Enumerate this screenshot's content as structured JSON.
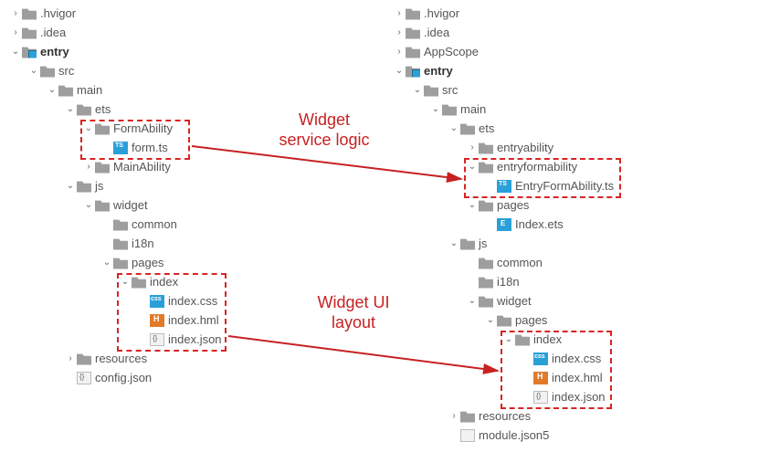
{
  "callouts": {
    "service": {
      "line1": "Widget",
      "line2": "service logic"
    },
    "ui": {
      "line1": "Widget UI",
      "line2": "layout"
    }
  },
  "left_tree": [
    {
      "indent": 0,
      "arrow": "right",
      "icon": "folder",
      "label": ".hvigor"
    },
    {
      "indent": 0,
      "arrow": "right",
      "icon": "folder",
      "label": ".idea"
    },
    {
      "indent": 0,
      "arrow": "down",
      "icon": "folder-blue",
      "label": "entry",
      "bold": true
    },
    {
      "indent": 1,
      "arrow": "down",
      "icon": "folder",
      "label": "src"
    },
    {
      "indent": 2,
      "arrow": "down",
      "icon": "folder",
      "label": "main"
    },
    {
      "indent": 3,
      "arrow": "down",
      "icon": "folder",
      "label": "ets"
    },
    {
      "indent": 4,
      "arrow": "down",
      "icon": "folder",
      "label": "FormAbility"
    },
    {
      "indent": 5,
      "arrow": "none",
      "icon": "file-ts",
      "label": "form.ts"
    },
    {
      "indent": 4,
      "arrow": "right",
      "icon": "folder",
      "label": "MainAbility"
    },
    {
      "indent": 3,
      "arrow": "down",
      "icon": "folder",
      "label": "js"
    },
    {
      "indent": 4,
      "arrow": "down",
      "icon": "folder",
      "label": "widget"
    },
    {
      "indent": 5,
      "arrow": "none",
      "icon": "folder",
      "label": "common"
    },
    {
      "indent": 5,
      "arrow": "none",
      "icon": "folder",
      "label": "i18n"
    },
    {
      "indent": 5,
      "arrow": "down",
      "icon": "folder",
      "label": "pages"
    },
    {
      "indent": 6,
      "arrow": "down",
      "icon": "folder",
      "label": "index"
    },
    {
      "indent": 7,
      "arrow": "none",
      "icon": "file-css",
      "label": "index.css"
    },
    {
      "indent": 7,
      "arrow": "none",
      "icon": "file-hml",
      "label": "index.hml"
    },
    {
      "indent": 7,
      "arrow": "none",
      "icon": "file-json",
      "label": "index.json"
    },
    {
      "indent": 3,
      "arrow": "right",
      "icon": "folder",
      "label": "resources"
    },
    {
      "indent": 3,
      "arrow": "none",
      "icon": "file-json",
      "label": "config.json"
    }
  ],
  "right_tree": [
    {
      "indent": 0,
      "arrow": "right",
      "icon": "folder",
      "label": ".hvigor"
    },
    {
      "indent": 0,
      "arrow": "right",
      "icon": "folder",
      "label": ".idea"
    },
    {
      "indent": 0,
      "arrow": "right",
      "icon": "folder",
      "label": "AppScope"
    },
    {
      "indent": 0,
      "arrow": "down",
      "icon": "folder-blue",
      "label": "entry",
      "bold": true
    },
    {
      "indent": 1,
      "arrow": "down",
      "icon": "folder",
      "label": "src"
    },
    {
      "indent": 2,
      "arrow": "down",
      "icon": "folder",
      "label": "main"
    },
    {
      "indent": 3,
      "arrow": "down",
      "icon": "folder",
      "label": "ets"
    },
    {
      "indent": 4,
      "arrow": "right",
      "icon": "folder",
      "label": "entryability"
    },
    {
      "indent": 4,
      "arrow": "down",
      "icon": "folder",
      "label": "entryformability"
    },
    {
      "indent": 5,
      "arrow": "none",
      "icon": "file-ts",
      "label": "EntryFormAbility.ts"
    },
    {
      "indent": 4,
      "arrow": "down",
      "icon": "folder",
      "label": "pages"
    },
    {
      "indent": 5,
      "arrow": "none",
      "icon": "file-ets",
      "label": "Index.ets"
    },
    {
      "indent": 3,
      "arrow": "down",
      "icon": "folder",
      "label": "js"
    },
    {
      "indent": 4,
      "arrow": "none",
      "icon": "folder",
      "label": "common"
    },
    {
      "indent": 4,
      "arrow": "none",
      "icon": "folder",
      "label": "i18n"
    },
    {
      "indent": 4,
      "arrow": "down",
      "icon": "folder",
      "label": "widget"
    },
    {
      "indent": 5,
      "arrow": "down",
      "icon": "folder",
      "label": "pages"
    },
    {
      "indent": 6,
      "arrow": "down",
      "icon": "folder",
      "label": "index"
    },
    {
      "indent": 7,
      "arrow": "none",
      "icon": "file-css",
      "label": "index.css"
    },
    {
      "indent": 7,
      "arrow": "none",
      "icon": "file-hml",
      "label": "index.hml"
    },
    {
      "indent": 7,
      "arrow": "none",
      "icon": "file-json",
      "label": "index.json"
    },
    {
      "indent": 3,
      "arrow": "right",
      "icon": "folder",
      "label": "resources"
    },
    {
      "indent": 3,
      "arrow": "none",
      "icon": "file-json5",
      "label": "module.json5"
    }
  ]
}
